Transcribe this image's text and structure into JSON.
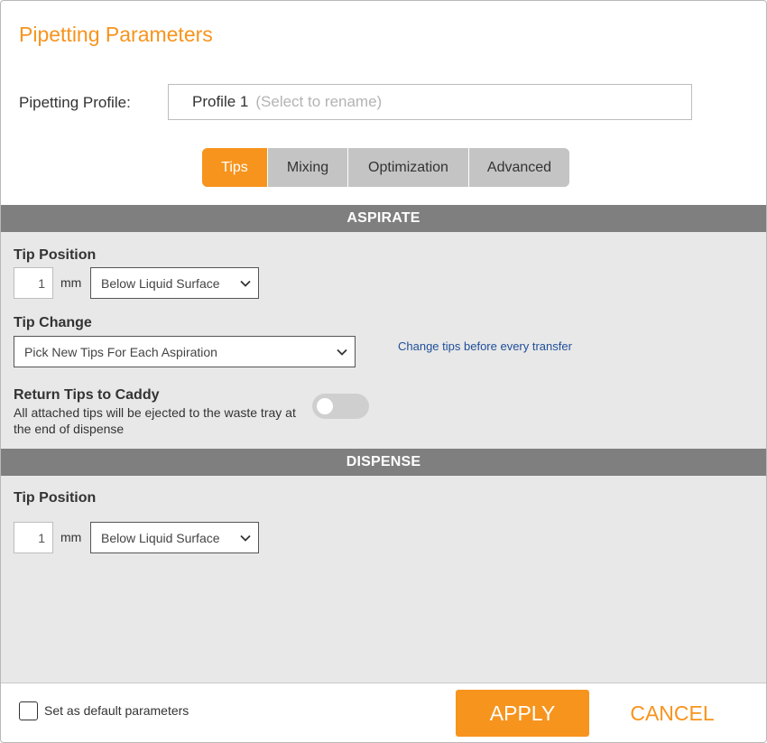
{
  "dialog": {
    "title": "Pipetting Parameters"
  },
  "profile": {
    "label": "Pipetting Profile:",
    "name": "Profile 1",
    "hint": "(Select to rename)"
  },
  "tabs": [
    {
      "label": "Tips",
      "active": true
    },
    {
      "label": "Mixing",
      "active": false
    },
    {
      "label": "Optimization",
      "active": false
    },
    {
      "label": "Advanced",
      "active": false
    }
  ],
  "aspirate": {
    "section_title": "ASPIRATE",
    "tip_position": {
      "label": "Tip Position",
      "value": "1",
      "unit": "mm",
      "reference": "Below Liquid Surface"
    },
    "tip_change": {
      "label": "Tip Change",
      "value": "Pick New Tips For Each Aspiration",
      "help_text": "Change tips before every transfer"
    },
    "return_tips": {
      "label": "Return Tips to Caddy",
      "description": "All attached tips will be ejected to the waste tray at the end of dispense",
      "enabled": false
    }
  },
  "dispense": {
    "section_title": "DISPENSE",
    "tip_position": {
      "label": "Tip Position",
      "value": "1",
      "unit": "mm",
      "reference": "Below Liquid Surface"
    }
  },
  "footer": {
    "default_label": "Set as default parameters",
    "default_checked": false,
    "apply_label": "APPLY",
    "cancel_label": "CANCEL"
  },
  "colors": {
    "accent": "#f7941d",
    "section_bar": "#7f7f7f",
    "content_bg": "#e8e8e8",
    "link": "#1f4e9a"
  }
}
